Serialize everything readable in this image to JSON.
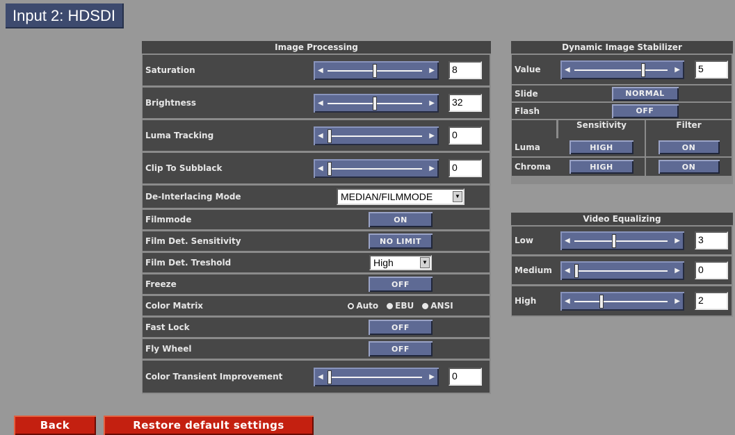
{
  "title": "Input 2: HDSDI",
  "image_processing": {
    "heading": "Image Processing",
    "saturation": {
      "label": "Saturation",
      "value": "8",
      "level": 0.5
    },
    "brightness": {
      "label": "Brightness",
      "value": "32",
      "level": 0.5
    },
    "luma_tracking": {
      "label": "Luma Tracking",
      "value": "0",
      "level": 0.0
    },
    "clip_to_subblack": {
      "label": "Clip To Subblack",
      "value": "0",
      "level": 0.0
    },
    "deinterlacing": {
      "label": "De-Interlacing Mode",
      "value": "MEDIAN/FILMMODE"
    },
    "filmmode": {
      "label": "Filmmode",
      "value": "ON"
    },
    "film_det_sensitivity": {
      "label": "Film Det. Sensitivity",
      "value": "NO LIMIT"
    },
    "film_det_threshold": {
      "label": "Film Det. Treshold",
      "value": "High"
    },
    "freeze": {
      "label": "Freeze",
      "value": "OFF"
    },
    "color_matrix": {
      "label": "Color Matrix",
      "options": [
        "Auto",
        "EBU",
        "ANSI"
      ],
      "selected": "Auto"
    },
    "fast_lock": {
      "label": "Fast Lock",
      "value": "OFF"
    },
    "fly_wheel": {
      "label": "Fly Wheel",
      "value": "OFF"
    },
    "cti": {
      "label": "Color Transient Improvement",
      "value": "0",
      "level": 0.0
    }
  },
  "dis": {
    "heading": "Dynamic Image Stabilizer",
    "value_label": "Value",
    "value": "5",
    "level": 0.75,
    "slide_label": "Slide",
    "slide_value": "NORMAL",
    "flash_label": "Flash",
    "flash_value": "OFF",
    "sensitivity_header": "Sensitivity",
    "filter_header": "Filter",
    "luma_label": "Luma",
    "luma_sensitivity": "HIGH",
    "luma_filter": "ON",
    "chroma_label": "Chroma",
    "chroma_sensitivity": "HIGH",
    "chroma_filter": "ON"
  },
  "video_eq": {
    "heading": "Video Equalizing",
    "low": {
      "label": "Low",
      "value": "3",
      "level": 0.42
    },
    "medium": {
      "label": "Medium",
      "value": "0",
      "level": 0.0
    },
    "high": {
      "label": "High",
      "value": "2",
      "level": 0.28
    }
  },
  "footer": {
    "back_label": "Back",
    "restore_label": "Restore default settings"
  },
  "icons": {
    "left_arrow": "◀",
    "right_arrow": "▶",
    "dropdown": "▼"
  },
  "colors": {
    "background": "#989898",
    "cell": "#474747",
    "control_blue": "#5e6a94",
    "button_red": "#c42010"
  }
}
